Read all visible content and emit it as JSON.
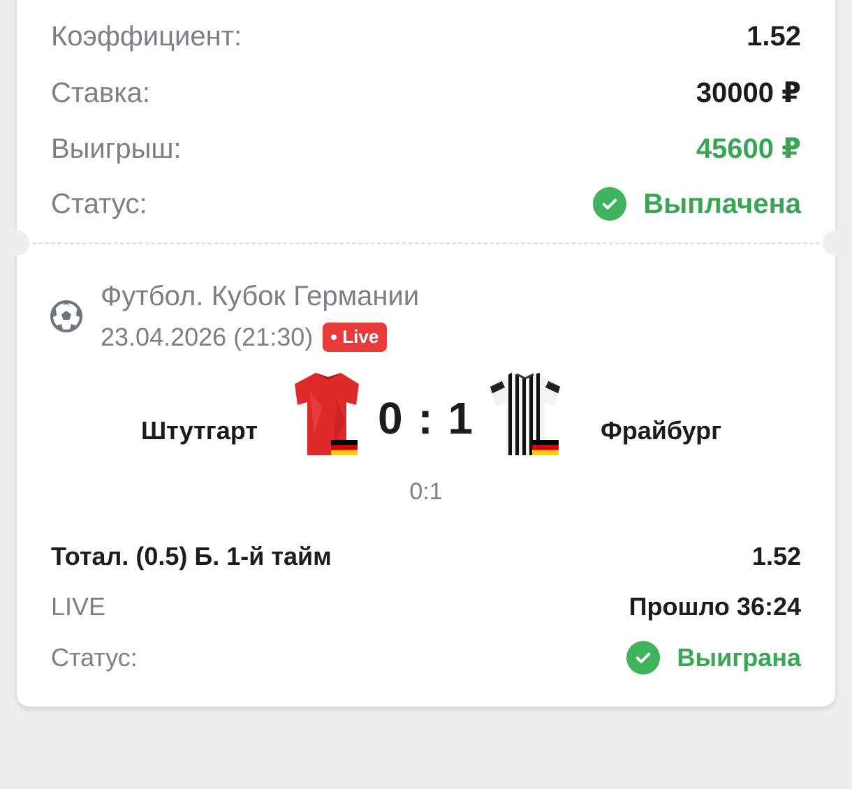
{
  "summary": {
    "coef_label": "Коэффициент:",
    "coef_value": "1.52",
    "stake_label": "Ставка:",
    "stake_value": "30000 ₽",
    "win_label": "Выигрыш:",
    "win_value": "45600 ₽",
    "status_label": "Статус:",
    "status_value": "Выплачена"
  },
  "event": {
    "league": "Футбол. Кубок Германии",
    "datetime": "23.04.2026 (21:30)",
    "live_badge": "Live",
    "sport_icon": "soccer-ball-icon",
    "home_team": "Штутгарт",
    "away_team": "Фрайбург",
    "home_kit_icon": "red-jersey-icon",
    "away_kit_icon": "black-white-striped-jersey-icon",
    "flag_icon": "germany-flag-icon",
    "score": "0 : 1",
    "half_score": "0:1"
  },
  "bet": {
    "market": "Тотал. (0.5) Б. 1-й тайм",
    "odds": "1.52",
    "mode_label": "LIVE",
    "elapsed": "Прошло 36:24",
    "status_label": "Статус:",
    "status_value": "Выиграна"
  },
  "colors": {
    "green": "#3aa655",
    "live_red": "#ea3a3a",
    "background": "#eceef0"
  }
}
